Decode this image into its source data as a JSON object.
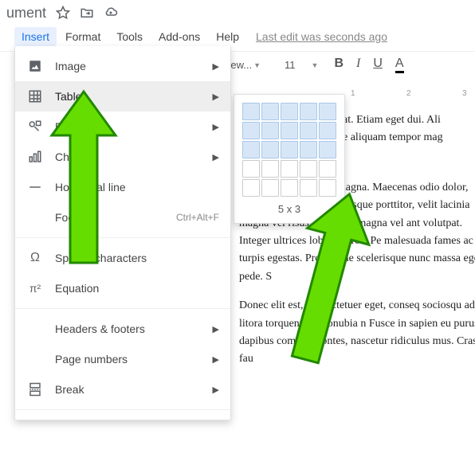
{
  "title": "ument",
  "menubar": {
    "insert": "Insert",
    "format": "Format",
    "tools": "Tools",
    "addons": "Add-ons",
    "help": "Help"
  },
  "lastedit": "Last edit was seconds ago",
  "toolbar": {
    "font": "New...",
    "size": "11",
    "bold": "B",
    "italic": "I",
    "underline": "U",
    "textcolor": "A"
  },
  "ruler": {
    "t1": "1",
    "t2": "2",
    "t3": "3"
  },
  "insertMenu": {
    "image": "Image",
    "table": "Table",
    "drawing": "Drawing",
    "chart": "Chart",
    "hline": "Horizontal line",
    "footnote": "Footnote",
    "footnote_sc": "Ctrl+Alt+F",
    "special": "Special characters",
    "equation": "Equation",
    "headers": "Headers & footers",
    "pagenumbers": "Page numbers",
    "break": "Break"
  },
  "tablePicker": {
    "caption": "5 x 3",
    "cols": 5,
    "selectedRows": 3,
    "totalRows": 5
  },
  "docbody": {
    "p1a": "at. Etiam eget dui. Ali",
    "p1b": "e aliquam tempor mag",
    "p2": "nt morbi tristique sen magna. Maecenas odio dolor, vulputate v felis. Pellentesque porttitor, velit lacinia magna vel risus. Cras non magna vel ant volutpat. Integer ultrices lobortis eros. Pe malesuada fames ac turpis egestas. Proin vitae scelerisque nunc massa eget pede. S",
    "p3": "Donec elit est, consectetuer eget, conseq sociosqu ad litora torquent per conubia n Fusce in sapien eu purus dapibus commo montes, nascetur ridiculus mus. Cras fau"
  }
}
